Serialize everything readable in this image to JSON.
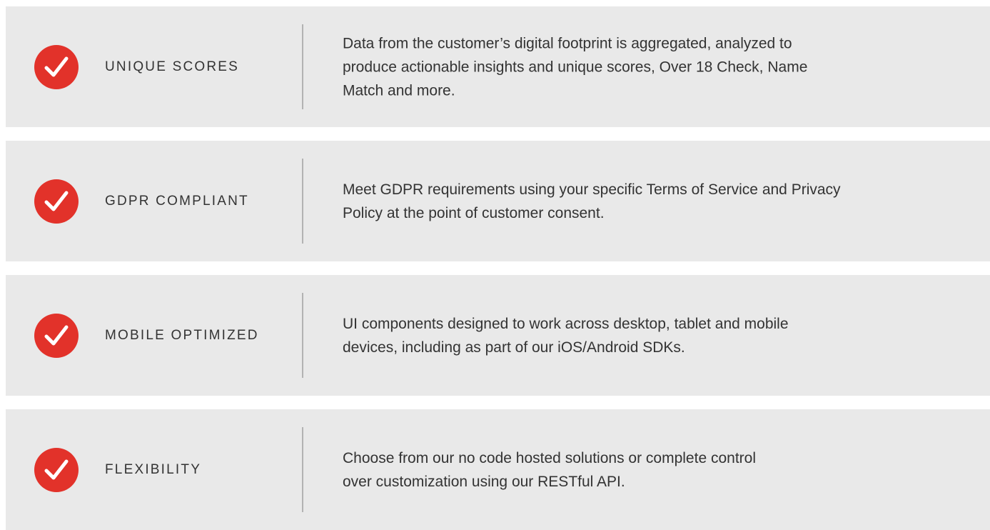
{
  "accent_color": "#e2322a",
  "card_background": "#e9e9e9",
  "features": [
    {
      "icon": "check-icon",
      "title": "UNIQUE SCORES",
      "description_lines": [
        "Data from the customer’s digital footprint is aggregated, analyzed to",
        "produce actionable insights and unique scores, Over 18 Check, Name",
        "Match and more."
      ]
    },
    {
      "icon": "check-icon",
      "title": "GDPR COMPLIANT",
      "description_lines": [
        "Meet GDPR requirements using your specific Terms of Service and Privacy",
        "Policy at the point of customer consent."
      ]
    },
    {
      "icon": "check-icon",
      "title": "MOBILE OPTIMIZED",
      "description_lines": [
        "UI components designed to work across desktop, tablet and mobile",
        "devices, including as part of our iOS/Android SDKs."
      ]
    },
    {
      "icon": "check-icon",
      "title": "FLEXIBILITY",
      "description_lines": [
        "Choose from our no code hosted solutions or complete control",
        "over customization using our RESTful API."
      ]
    }
  ]
}
